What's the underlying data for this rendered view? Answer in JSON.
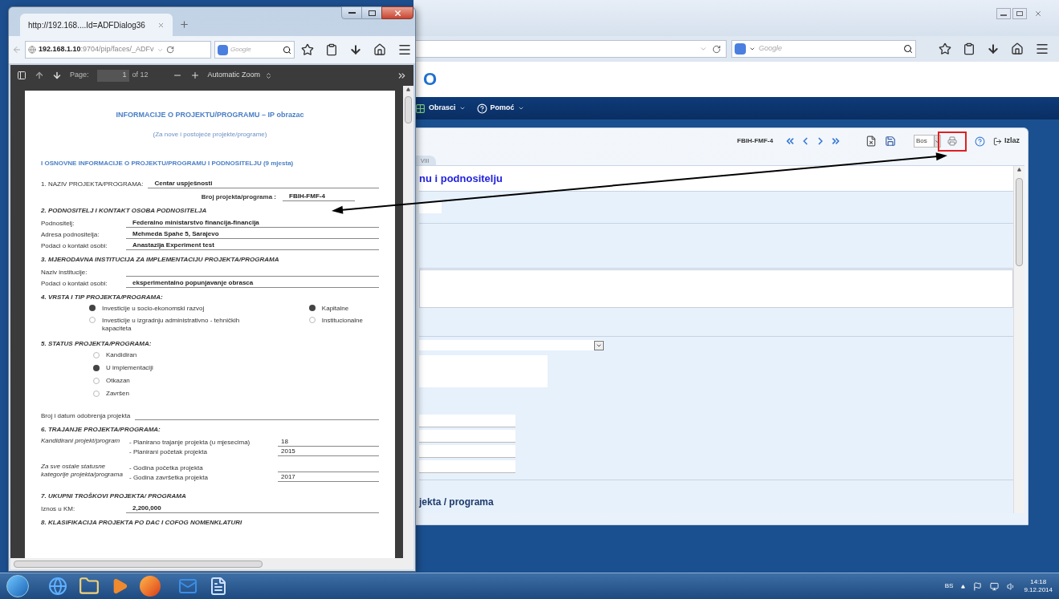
{
  "main_window": {
    "search_placeholder": "Google",
    "logo": "O"
  },
  "app_menu": [
    {
      "label": "Obrasci"
    },
    {
      "label": "Pomoć"
    }
  ],
  "form_toolbar": {
    "form_code": "FBIH-FMF-4",
    "language": "Bos",
    "exit": "Izlaz"
  },
  "tab_fragment": "VIII",
  "section_title": "nu i podnositelju",
  "section_footer": "jekta / programa",
  "popup": {
    "tab_title": "http://192.168....Id=ADFDialog36",
    "url_host": "192.168.1.10",
    "url_path": ":9704/pip/faces/_ADFv",
    "search_placeholder": "Google",
    "pdf_toolbar": {
      "page_label": "Page:",
      "page": "1",
      "page_count": "of 12",
      "zoom": "Automatic Zoom"
    },
    "document": [
      {
        "kind": "title",
        "text": "INFORMACIJE O PROJEKTU/PROGRAMU – IP obrazac"
      },
      {
        "kind": "subtitle",
        "text": "(Za nove i postojeće projekte/programe)"
      },
      {
        "kind": "section",
        "text": "I OSNOVNE INFORMACIJE O PROJEKTU/PROGRAMU I PODNOSITELJU (9 mjesta)"
      },
      {
        "kind": "field",
        "label": "1. NAZIV PROJEKTA/PROGRAMA:",
        "value": "Centar uspješnosti"
      },
      {
        "kind": "field_right",
        "label": "Broj projekta/programa :",
        "value": "FBIH-FMF-4"
      },
      {
        "kind": "heading",
        "text": "2. PODNOSITELJ I KONTAKT OSOBA PODNOSITELJA"
      },
      {
        "kind": "field",
        "label": "Podnositelj:",
        "value": "Federalno ministarstvo financija-financija"
      },
      {
        "kind": "field",
        "label": "Adresa podnositelja:",
        "value": "Mehmeda Spahe 5, Sarajevo"
      },
      {
        "kind": "field",
        "label": "Podaci o kontakt osobi:",
        "value": "Anastazija Experiment test"
      },
      {
        "kind": "heading",
        "text": "3. MJERODAVNA INSTITUCIJA ZA IMPLEMENTACIJU PROJEKTA/PROGRAMA"
      },
      {
        "kind": "field",
        "label": "Naziv institucije:"
      },
      {
        "kind": "field",
        "label": "Podaci o kontakt osobi:",
        "value": "eksperimentalno popunjavanje obrasca"
      },
      {
        "kind": "heading",
        "text": "4. VRSTA I TIP PROJEKTA/PROGRAMA:"
      },
      {
        "kind": "radio_grid",
        "left": [
          {
            "label": "Investicije u socio-ekonomski razvoj",
            "selected": true
          },
          {
            "label": "Investicije u izgradnju administrativno - tehničkih kapaciteta",
            "selected": false
          }
        ],
        "right": [
          {
            "label": "Kapitalne",
            "selected": true
          },
          {
            "label": "Institucionalne",
            "selected": false
          }
        ]
      },
      {
        "kind": "heading",
        "text": "5. STATUS PROJEKTA/PROGRAMA:"
      },
      {
        "kind": "radio_list",
        "options": [
          {
            "label": "Kandidiran",
            "selected": false
          },
          {
            "label": "U implementaciji",
            "selected": true
          },
          {
            "label": "Otkazan",
            "selected": false
          },
          {
            "label": "Završen",
            "selected": false
          }
        ]
      },
      {
        "kind": "field",
        "label": "Broj i datum odobrenja projekta"
      },
      {
        "kind": "heading",
        "text": "6. TRAJANJE PROJEKTA/PROGRAMA:"
      },
      {
        "kind": "duration",
        "label": "Kandidirani projekt/program",
        "items": [
          {
            "label": "- Planirano trajanje projekta (u mjesecima)",
            "value": "18"
          },
          {
            "label": "- Planirani početak projekta",
            "value": "2015"
          }
        ]
      },
      {
        "kind": "duration",
        "label": "Za sve ostale statusne kategorije projekta/programa",
        "items": [
          {
            "label": "- Godina početka projekta"
          },
          {
            "label": "- Godina završetka projekta",
            "value": "2017"
          }
        ]
      },
      {
        "kind": "heading",
        "text": "7. UKUPNI TROŠKOVI PROJEKTA/ PROGRAMA"
      },
      {
        "kind": "field",
        "label": "Iznos u KM:",
        "value": "2,200,000"
      },
      {
        "kind": "heading",
        "text": "8. KLASIFIKACIJA PROJEKTA PO DAC I COFOG NOMENKLATURI"
      }
    ]
  },
  "taskbar": {
    "language": "BS",
    "time": "14:18",
    "date": "9.12.2014"
  }
}
